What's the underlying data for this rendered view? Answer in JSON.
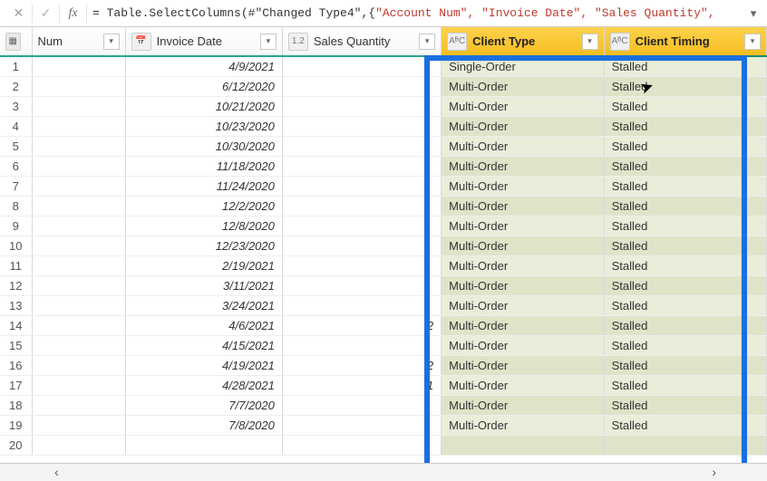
{
  "formula": {
    "prefix": "= Table.SelectColumns(#",
    "step_name": "\"Changed Type4\"",
    "comma_brace": ",{",
    "cols_joined": "\"Account Num\", \"Invoice Date\", \"Sales Quantity\","
  },
  "columns": {
    "rowhdr_icon": "▦",
    "num": {
      "label": "Num",
      "type_icon": ""
    },
    "date": {
      "label": "Invoice Date",
      "type_icon": "📅"
    },
    "qty": {
      "label": "Sales Quantity",
      "type_icon": "1.2"
    },
    "type": {
      "label": "Client Type",
      "type_icon": "AᴮC"
    },
    "timing": {
      "label": "Client Timing",
      "type_icon": "AᴮC"
    }
  },
  "rows": [
    {
      "n": 1,
      "date": "4/9/2021",
      "qty": "",
      "type": "Single-Order",
      "timing": "Stalled"
    },
    {
      "n": 2,
      "date": "6/12/2020",
      "qty": "",
      "type": "Multi-Order",
      "timing": "Stalled"
    },
    {
      "n": 3,
      "date": "10/21/2020",
      "qty": "",
      "type": "Multi-Order",
      "timing": "Stalled"
    },
    {
      "n": 4,
      "date": "10/23/2020",
      "qty": "",
      "type": "Multi-Order",
      "timing": "Stalled"
    },
    {
      "n": 5,
      "date": "10/30/2020",
      "qty": "",
      "type": "Multi-Order",
      "timing": "Stalled"
    },
    {
      "n": 6,
      "date": "11/18/2020",
      "qty": "",
      "type": "Multi-Order",
      "timing": "Stalled"
    },
    {
      "n": 7,
      "date": "11/24/2020",
      "qty": "",
      "type": "Multi-Order",
      "timing": "Stalled"
    },
    {
      "n": 8,
      "date": "12/2/2020",
      "qty": "",
      "type": "Multi-Order",
      "timing": "Stalled"
    },
    {
      "n": 9,
      "date": "12/8/2020",
      "qty": "",
      "type": "Multi-Order",
      "timing": "Stalled"
    },
    {
      "n": 10,
      "date": "12/23/2020",
      "qty": "",
      "type": "Multi-Order",
      "timing": "Stalled"
    },
    {
      "n": 11,
      "date": "2/19/2021",
      "qty": "",
      "type": "Multi-Order",
      "timing": "Stalled"
    },
    {
      "n": 12,
      "date": "3/11/2021",
      "qty": "",
      "type": "Multi-Order",
      "timing": "Stalled"
    },
    {
      "n": 13,
      "date": "3/24/2021",
      "qty": "",
      "type": "Multi-Order",
      "timing": "Stalled"
    },
    {
      "n": 14,
      "date": "4/6/2021",
      "qty": "2",
      "type": "Multi-Order",
      "timing": "Stalled"
    },
    {
      "n": 15,
      "date": "4/15/2021",
      "qty": "",
      "type": "Multi-Order",
      "timing": "Stalled"
    },
    {
      "n": 16,
      "date": "4/19/2021",
      "qty": "2",
      "type": "Multi-Order",
      "timing": "Stalled"
    },
    {
      "n": 17,
      "date": "4/28/2021",
      "qty": "1",
      "type": "Multi-Order",
      "timing": "Stalled"
    },
    {
      "n": 18,
      "date": "7/7/2020",
      "qty": "",
      "type": "Multi-Order",
      "timing": "Stalled"
    },
    {
      "n": 19,
      "date": "7/8/2020",
      "qty": "",
      "type": "Multi-Order",
      "timing": "Stalled"
    },
    {
      "n": 20,
      "date": "",
      "qty": "",
      "type": "",
      "timing": ""
    }
  ],
  "glyphs": {
    "cancel": "✕",
    "confirm": "✓",
    "fx": "fx",
    "dropdown": "▾",
    "filter": "▾",
    "cursor": "➤",
    "scroll_left": "‹",
    "scroll_right": "›"
  }
}
